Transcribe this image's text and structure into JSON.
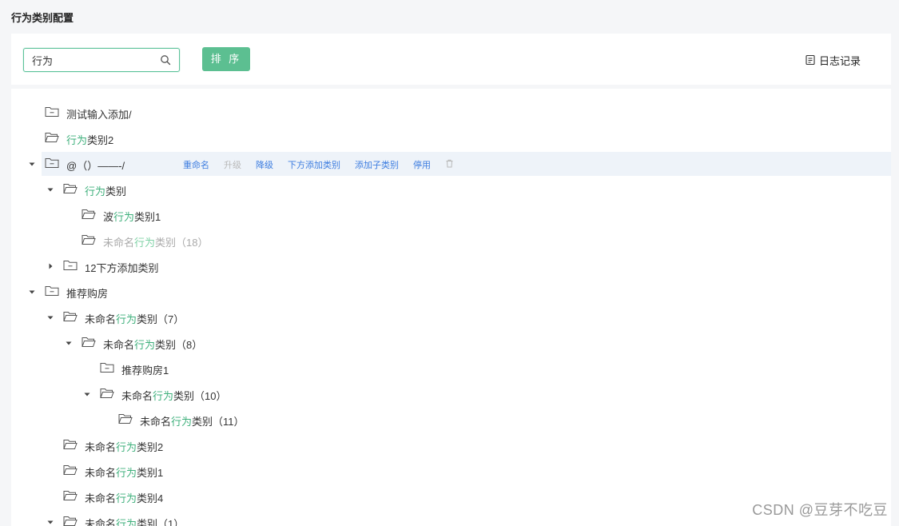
{
  "page": {
    "title": "行为类别配置"
  },
  "toolbar": {
    "search_value": "行为",
    "search_icon": "search-icon",
    "sort_label": "排 序",
    "log_label": "日志记录",
    "log_icon": "document-icon",
    "accent_color": "#5cbf91"
  },
  "tree": {
    "highlight_color": "#3fb07c",
    "action_color": "#3d7de0",
    "selected_actions": [
      {
        "label": "重命名",
        "enabled": true
      },
      {
        "label": "升级",
        "enabled": false
      },
      {
        "label": "降级",
        "enabled": true
      },
      {
        "label": "下方添加类别",
        "enabled": true
      },
      {
        "label": "添加子类别",
        "enabled": true
      },
      {
        "label": "停用",
        "enabled": true
      }
    ],
    "nodes": [
      {
        "level": 0,
        "expanded": null,
        "icon": "folder-minus",
        "parts": [
          {
            "t": "测试输入添加/"
          }
        ]
      },
      {
        "level": 0,
        "expanded": null,
        "icon": "folder-open",
        "parts": [
          {
            "t": "行为",
            "h": true
          },
          {
            "t": "类别2"
          }
        ]
      },
      {
        "level": 0,
        "expanded": true,
        "icon": "folder-minus",
        "selected": true,
        "parts": [
          {
            "t": "@（）——-/"
          }
        ]
      },
      {
        "level": 1,
        "expanded": true,
        "icon": "folder-open",
        "parts": [
          {
            "t": "行为",
            "h": true
          },
          {
            "t": "类别"
          }
        ]
      },
      {
        "level": 2,
        "expanded": null,
        "icon": "folder-open",
        "parts": [
          {
            "t": "波"
          },
          {
            "t": "行为",
            "h": true
          },
          {
            "t": "类别1"
          }
        ]
      },
      {
        "level": 2,
        "expanded": null,
        "icon": "folder-open",
        "disabled": true,
        "parts": [
          {
            "t": "未命名"
          },
          {
            "t": "行为",
            "h": true
          },
          {
            "t": "类别（18）"
          }
        ]
      },
      {
        "level": 1,
        "expanded": false,
        "icon": "folder-minus",
        "parts": [
          {
            "t": "12下方添加类别"
          }
        ]
      },
      {
        "level": 0,
        "expanded": true,
        "icon": "folder-minus",
        "parts": [
          {
            "t": "推荐购房"
          }
        ]
      },
      {
        "level": 1,
        "expanded": true,
        "icon": "folder-open",
        "parts": [
          {
            "t": "未命名"
          },
          {
            "t": "行为",
            "h": true
          },
          {
            "t": "类别（7）"
          }
        ]
      },
      {
        "level": 2,
        "expanded": true,
        "icon": "folder-open",
        "parts": [
          {
            "t": "未命名"
          },
          {
            "t": "行为",
            "h": true
          },
          {
            "t": "类别（8）"
          }
        ]
      },
      {
        "level": 3,
        "expanded": null,
        "icon": "folder-minus",
        "parts": [
          {
            "t": "推荐购房1"
          }
        ]
      },
      {
        "level": 3,
        "expanded": true,
        "icon": "folder-open",
        "parts": [
          {
            "t": "未命名"
          },
          {
            "t": "行为",
            "h": true
          },
          {
            "t": "类别（10）"
          }
        ]
      },
      {
        "level": 4,
        "expanded": null,
        "icon": "folder-open",
        "parts": [
          {
            "t": "未命名"
          },
          {
            "t": "行为",
            "h": true
          },
          {
            "t": "类别（11）"
          }
        ]
      },
      {
        "level": 1,
        "expanded": null,
        "icon": "folder-open",
        "parts": [
          {
            "t": "未命名"
          },
          {
            "t": "行为",
            "h": true
          },
          {
            "t": "类别2"
          }
        ]
      },
      {
        "level": 1,
        "expanded": null,
        "icon": "folder-open",
        "parts": [
          {
            "t": "未命名"
          },
          {
            "t": "行为",
            "h": true
          },
          {
            "t": "类别1"
          }
        ]
      },
      {
        "level": 1,
        "expanded": null,
        "icon": "folder-open",
        "parts": [
          {
            "t": "未命名"
          },
          {
            "t": "行为",
            "h": true
          },
          {
            "t": "类别4"
          }
        ]
      },
      {
        "level": 1,
        "expanded": true,
        "icon": "folder-open",
        "parts": [
          {
            "t": "未命名"
          },
          {
            "t": "行为",
            "h": true
          },
          {
            "t": "类别（1）"
          }
        ]
      }
    ]
  },
  "watermark": "CSDN @豆芽不吃豆"
}
